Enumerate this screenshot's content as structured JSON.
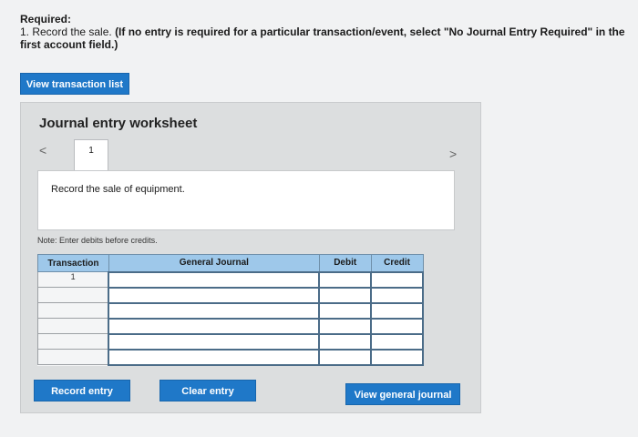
{
  "required": {
    "heading": "Required:",
    "instruction_prefix": "1. Record the sale. ",
    "instruction_bold": "(If no entry is required for a particular transaction/event, select \"No Journal Entry Required\" in the first account field.)"
  },
  "buttons": {
    "view_transaction_list": "View transaction list",
    "record_entry": "Record entry",
    "clear_entry": "Clear entry",
    "view_general_journal": "View general journal"
  },
  "worksheet": {
    "title": "Journal entry worksheet",
    "nav_prev": "<",
    "nav_next": ">",
    "tab_number": "1",
    "description": "Record the sale of equipment.",
    "note": "Note: Enter debits before credits."
  },
  "table": {
    "headers": [
      "Transaction",
      "General Journal",
      "Debit",
      "Credit"
    ],
    "rows": [
      {
        "transaction": "1"
      },
      {
        "transaction": ""
      },
      {
        "transaction": ""
      },
      {
        "transaction": ""
      },
      {
        "transaction": ""
      },
      {
        "transaction": ""
      }
    ]
  }
}
